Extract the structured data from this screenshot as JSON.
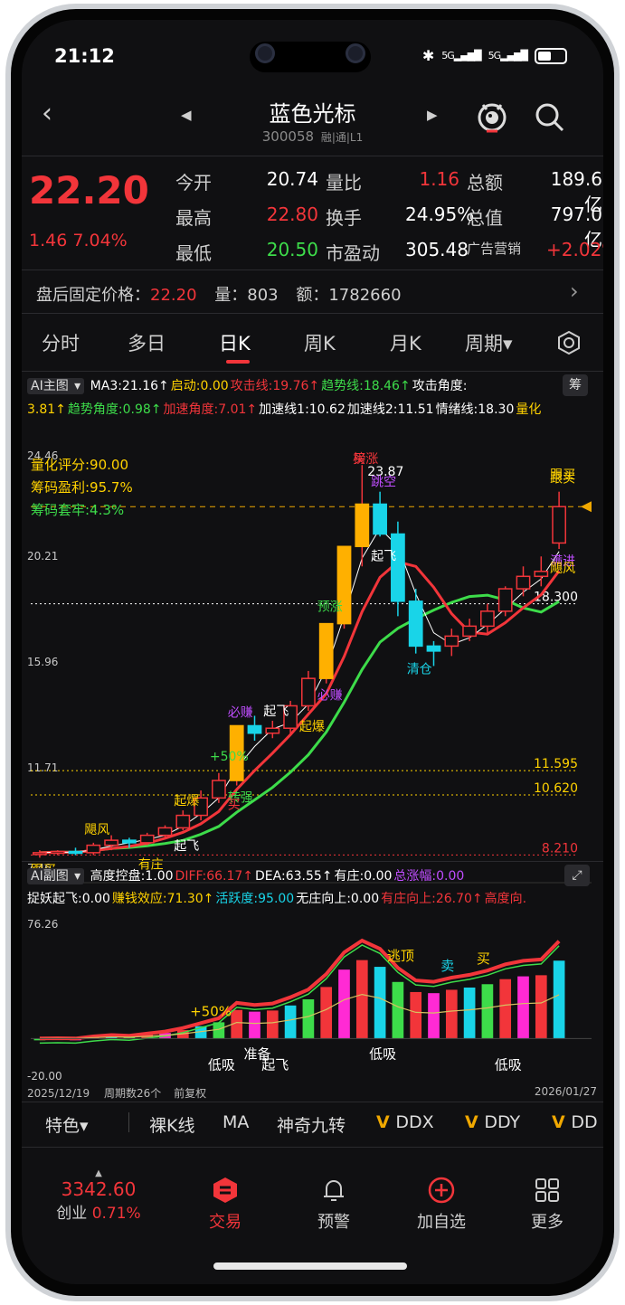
{
  "status": {
    "time": "21:12",
    "signal1": "5G",
    "signal2": "5G"
  },
  "header": {
    "title": "蓝色光标",
    "code": "300058",
    "badge": "融|通|L1"
  },
  "quote": {
    "price": "22.20",
    "change": "1.46",
    "change_pct": "7.04%",
    "rows": [
      [
        {
          "l": "今开"
        },
        {
          "v": "20.74",
          "c": "#ffffff"
        },
        {
          "l": "量比"
        },
        {
          "v": "1.16",
          "c": "#f2353a"
        },
        {
          "l": "总额"
        },
        {
          "v": "189.6亿",
          "c": "#ffffff"
        }
      ],
      [
        {
          "l": "最高"
        },
        {
          "v": "22.80",
          "c": "#f2353a"
        },
        {
          "l": "换手"
        },
        {
          "v": "24.95%",
          "c": "#ffffff"
        },
        {
          "l": "总值"
        },
        {
          "v": "797.0亿",
          "c": "#ffffff"
        }
      ],
      [
        {
          "l": "最低"
        },
        {
          "v": "20.50",
          "c": "#3ddc4a"
        },
        {
          "l": "市盈动"
        },
        {
          "v": "305.48",
          "c": "#ffffff"
        },
        {
          "l": "广告营销"
        },
        {
          "v": "+2.02%",
          "c": "#f2353a"
        }
      ]
    ]
  },
  "after_hours": {
    "label": "盘后固定价格：",
    "price": "22.20",
    "vol_label": "量：",
    "vol": "803",
    "amt_label": "额：",
    "amt": "1782660"
  },
  "tabs": [
    {
      "label": "分时"
    },
    {
      "label": "多日"
    },
    {
      "label": "日K"
    },
    {
      "label": "周K"
    },
    {
      "label": "月K"
    },
    {
      "label": "周期▾"
    }
  ],
  "main_legend": {
    "selector": "AI主图",
    "chip_icon": "筹",
    "line1": [
      {
        "t": "MA3:21.16↑",
        "c": "#ffffff"
      },
      {
        "t": "启动:0.00",
        "c": "#ffd200"
      },
      {
        "t": "攻击线:19.76↑",
        "c": "#f2353a"
      },
      {
        "t": "趋势线:18.46↑",
        "c": "#3ddc4a"
      },
      {
        "t": "攻击角度:",
        "c": "#ffffff"
      }
    ],
    "line2": [
      {
        "t": "3.81↑",
        "c": "#ffd200"
      },
      {
        "t": "趋势角度:0.98↑",
        "c": "#3ddc4a"
      },
      {
        "t": "加速角度:7.01↑",
        "c": "#f2353a"
      },
      {
        "t": "加速线1:10.62",
        "c": "#ffffff"
      },
      {
        "t": "加速线2:11.51",
        "c": "#ffffff"
      },
      {
        "t": "情绪线:18.30",
        "c": "#ffffff"
      },
      {
        "t": "量化",
        "c": "#ffd200"
      }
    ]
  },
  "main_info": [
    {
      "t": "量化评分:90.00",
      "c": "#ffd200"
    },
    {
      "t": "筹码盈利:95.7%",
      "c": "#ffd200"
    },
    {
      "t": "筹码套牢:4.3%",
      "c": "#3ddc4a"
    }
  ],
  "chart_data": {
    "type": "candlestick",
    "y_axis_ticks": [
      "24.46",
      "20.21",
      "15.96",
      "11.71",
      "7.46"
    ],
    "ylim": [
      7.46,
      24.46
    ],
    "peak_label": "23.87",
    "price_levels": [
      {
        "label": "18.300",
        "value": 18.3,
        "c": "#ffffff"
      },
      {
        "label": "11.595",
        "value": 11.595,
        "c": "#ffd200"
      },
      {
        "label": "10.620",
        "value": 10.62,
        "c": "#ffd200"
      },
      {
        "label": "8.210",
        "value": 8.21,
        "c": "#f2353a"
      }
    ],
    "dashed_level": 22.2,
    "candles": [
      [
        8.3,
        8.4,
        8.1,
        8.3
      ],
      [
        8.3,
        8.4,
        8.2,
        8.35
      ],
      [
        8.35,
        8.5,
        8.2,
        8.3
      ],
      [
        8.3,
        8.7,
        8.2,
        8.6
      ],
      [
        8.6,
        9.0,
        8.4,
        8.8
      ],
      [
        8.8,
        8.9,
        8.5,
        8.7
      ],
      [
        8.7,
        9.1,
        8.6,
        9.0
      ],
      [
        9.0,
        9.4,
        8.9,
        9.3
      ],
      [
        9.3,
        10.0,
        9.2,
        9.8
      ],
      [
        9.8,
        10.8,
        9.6,
        10.5
      ],
      [
        10.5,
        11.5,
        10.3,
        11.2
      ],
      [
        11.2,
        13.4,
        11.0,
        13.4
      ],
      [
        13.4,
        13.8,
        12.8,
        13.1
      ],
      [
        13.1,
        13.6,
        12.9,
        13.3
      ],
      [
        13.3,
        14.4,
        13.0,
        14.2
      ],
      [
        14.2,
        15.6,
        14.0,
        15.3
      ],
      [
        15.3,
        17.5,
        15.1,
        17.5
      ],
      [
        17.5,
        20.6,
        17.3,
        20.6
      ],
      [
        20.6,
        23.87,
        19.8,
        22.3
      ],
      [
        22.3,
        22.8,
        21.0,
        21.1
      ],
      [
        21.1,
        21.6,
        17.8,
        18.4
      ],
      [
        18.4,
        18.9,
        16.3,
        16.6
      ],
      [
        16.6,
        16.8,
        15.8,
        16.4
      ],
      [
        16.6,
        17.3,
        16.2,
        17.0
      ],
      [
        17.0,
        17.7,
        16.8,
        17.4
      ],
      [
        17.4,
        18.3,
        17.1,
        18.0
      ],
      [
        18.0,
        19.0,
        17.8,
        18.9
      ],
      [
        18.9,
        19.8,
        18.6,
        19.4
      ],
      [
        19.4,
        20.2,
        19.0,
        19.6
      ],
      [
        20.74,
        22.8,
        20.5,
        22.2
      ]
    ],
    "labels": [
      {
        "t": "跟买",
        "c": "#ffd200"
      },
      {
        "t": "飓风",
        "c": "#ffd200"
      },
      {
        "t": "有庄",
        "c": "#ffd200"
      },
      {
        "t": "起爆",
        "c": "#ffd200"
      },
      {
        "t": "起飞",
        "c": "#ffffff"
      },
      {
        "t": "+50%",
        "c": "#3ddc4a"
      },
      {
        "t": "转强",
        "c": "#3ddc4a"
      },
      {
        "t": "必赚",
        "c": "#c04dff"
      },
      {
        "t": "买",
        "c": "#f2353a"
      },
      {
        "t": "起飞",
        "c": "#ffffff"
      },
      {
        "t": "起爆",
        "c": "#ffd200"
      },
      {
        "t": "预涨",
        "c": "#3ddc4a"
      },
      {
        "t": "必赚",
        "c": "#c04dff"
      },
      {
        "t": "买",
        "c": "#f2353a"
      },
      {
        "t": "起飞",
        "c": "#ffffff"
      },
      {
        "t": "跳空",
        "c": "#c04dff"
      },
      {
        "t": "清仓",
        "c": "#19d4e8"
      },
      {
        "t": "跟买",
        "c": "#ffd200"
      },
      {
        "t": "满进",
        "c": "#c04dff"
      },
      {
        "t": "跟买",
        "c": "#ffd200"
      },
      {
        "t": "飓风",
        "c": "#ffd200"
      },
      {
        "t": "榜涨",
        "c": "#f2353a"
      }
    ]
  },
  "sub_legend": {
    "selector": "AI副图",
    "line1": [
      {
        "t": "高度控盘:1.00",
        "c": "#ffffff"
      },
      {
        "t": "DIFF:66.17↑",
        "c": "#f2353a"
      },
      {
        "t": "DEA:63.55↑",
        "c": "#ffffff"
      },
      {
        "t": "有庄:0.00",
        "c": "#ffffff"
      },
      {
        "t": "总涨幅:0.00",
        "c": "#c04dff"
      }
    ],
    "line2": [
      {
        "t": "捉妖起飞:0.00",
        "c": "#ffffff"
      },
      {
        "t": "赚钱效应:71.30↑",
        "c": "#ffd200"
      },
      {
        "t": "活跃度:95.00",
        "c": "#19d4e8"
      },
      {
        "t": "无庄向上:0.00",
        "c": "#ffffff"
      },
      {
        "t": "有庄向上:26.70↑",
        "c": "#f2353a"
      },
      {
        "t": "高度向.",
        "c": "#f2353a"
      }
    ]
  },
  "sub_chart": {
    "ylim": [
      -20.0,
      76.26
    ],
    "y_top": "76.26",
    "y_bottom": "-20.00",
    "labels": [
      {
        "t": "+50%",
        "c": "#ffd200"
      },
      {
        "t": "低吸",
        "c": "#ffffff"
      },
      {
        "t": "准备",
        "c": "#ffffff"
      },
      {
        "t": "起飞",
        "c": "#ffffff"
      },
      {
        "t": "低吸",
        "c": "#ffffff"
      },
      {
        "t": "低吸",
        "c": "#ffffff"
      },
      {
        "t": "逃顶",
        "c": "#ffd200"
      },
      {
        "t": "卖",
        "c": "#19d4e8"
      },
      {
        "t": "买",
        "c": "#ffd200"
      }
    ]
  },
  "date_bar": {
    "start": "2025/12/19",
    "period": "周期数26个",
    "adjust": "前复权",
    "end": "2026/01/27"
  },
  "indicator_toolbar": {
    "feature": "特色▾",
    "items": [
      {
        "t": "裸K线"
      },
      {
        "t": "MA"
      },
      {
        "t": "神奇九转"
      },
      {
        "t": "DDX"
      },
      {
        "t": "DDY"
      },
      {
        "t": "DD"
      }
    ]
  },
  "bottom_nav": {
    "index_value": "3342.60",
    "index_name": "创业",
    "index_change": "0.71%",
    "items": [
      {
        "t": "交易"
      },
      {
        "t": "预警"
      },
      {
        "t": "加自选"
      },
      {
        "t": "更多"
      }
    ]
  }
}
